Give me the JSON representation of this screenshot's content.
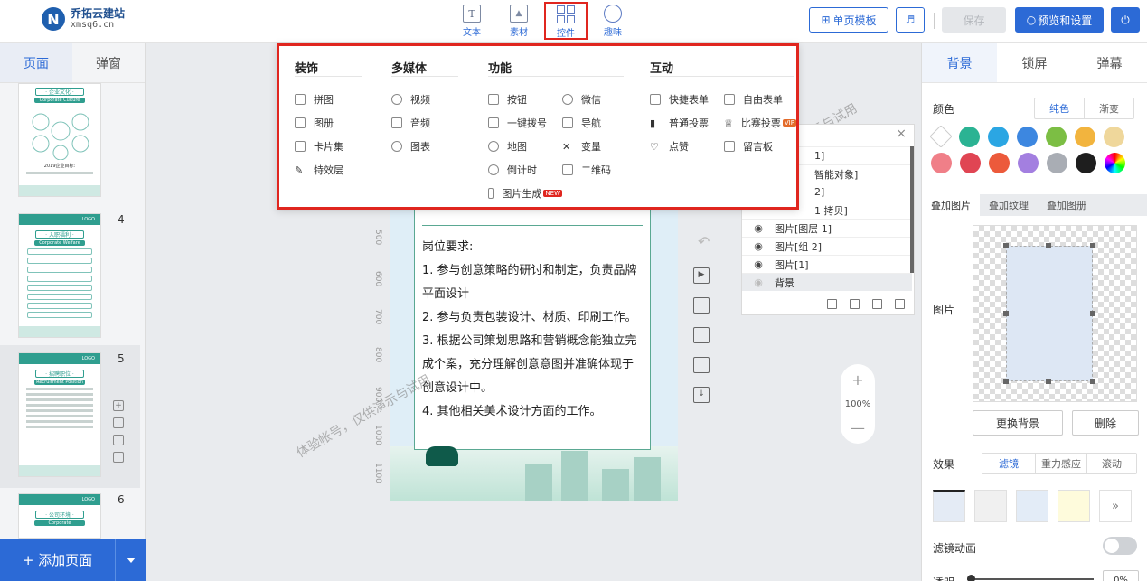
{
  "app": {
    "logo_mark": "N",
    "name": "乔拓云建站",
    "domain": "xmsq6.cn"
  },
  "toolbar": {
    "tools": [
      {
        "label": "文本",
        "icon": "text-icon",
        "glyph": "T"
      },
      {
        "label": "素材",
        "icon": "image-icon",
        "glyph": "▲"
      },
      {
        "label": "控件",
        "icon": "widget-grid-icon",
        "glyph": ""
      },
      {
        "label": "趣味",
        "icon": "bulb-icon",
        "glyph": ""
      }
    ],
    "template_label": "单页模板",
    "music_glyph": "♬",
    "save_label": "保存",
    "preview_label": "预览和设置",
    "power_glyph": "⏻",
    "template_icon": "⊞",
    "search_glyph": "○"
  },
  "left": {
    "tabs": [
      "页面",
      "弹窗"
    ],
    "pages": [
      {
        "num": "",
        "title": "· 企业文化 ·",
        "sub": "Corporate Culture",
        "caption": "2019企业目标:"
      },
      {
        "num": "4",
        "title": "· 入职福利 ·",
        "sub": "Corporate Welfare",
        "logo": "LOGO"
      },
      {
        "num": "5",
        "title": "· 招聘职位 ·",
        "sub": "Recruitment Position",
        "logo": "LOGO"
      },
      {
        "num": "6",
        "title": "· 公司环境 ·",
        "sub": "Corporate Environment",
        "logo": "LOGO"
      }
    ],
    "add_page_label": "+ 添加页面"
  },
  "dropdown": {
    "columns": [
      {
        "head": "装饰",
        "items": [
          {
            "label": "拼图",
            "icon": "puzzle-icon"
          },
          {
            "label": "图册",
            "icon": "album-icon"
          },
          {
            "label": "卡片集",
            "icon": "card-set-icon"
          },
          {
            "label": "特效层",
            "icon": "effect-layer-icon"
          }
        ]
      },
      {
        "head": "多媒体",
        "items": [
          {
            "label": "视频",
            "icon": "video-icon"
          },
          {
            "label": "音频",
            "icon": "audio-icon"
          },
          {
            "label": "图表",
            "icon": "chart-icon"
          }
        ]
      },
      {
        "head": "功能",
        "items": [
          {
            "label": "按钮",
            "icon": "button-icon"
          },
          {
            "label": "一键拨号",
            "icon": "phone-dial-icon"
          },
          {
            "label": "地图",
            "icon": "map-pin-icon"
          },
          {
            "label": "倒计时",
            "icon": "clock-icon"
          },
          {
            "label": "图片生成",
            "icon": "image-gen-icon",
            "badge": "NEW"
          }
        ]
      },
      {
        "head": "",
        "items": [
          {
            "label": "微信",
            "icon": "wechat-icon"
          },
          {
            "label": "导航",
            "icon": "nav-icon"
          },
          {
            "label": "变量",
            "icon": "variable-icon"
          },
          {
            "label": "二维码",
            "icon": "qrcode-icon"
          }
        ]
      },
      {
        "head": "互动",
        "items": [
          {
            "label": "快捷表单",
            "icon": "quick-form-icon"
          },
          {
            "label": "普通投票",
            "icon": "vote-icon"
          },
          {
            "label": "点赞",
            "icon": "heart-icon"
          }
        ]
      },
      {
        "head": "",
        "items": [
          {
            "label": "自由表单",
            "icon": "free-form-icon"
          },
          {
            "label": "比赛投票",
            "icon": "trophy-icon",
            "badge": "VIP"
          },
          {
            "label": "留言板",
            "icon": "message-board-icon"
          }
        ]
      }
    ]
  },
  "canvas": {
    "content_lines": [
      "岗位要求:",
      "1. 参与创意策略的研讨和制定，负责品牌",
      "平面设计",
      "2. 参与负责包装设计、材质、印刷工作。",
      "3. 根据公司策划思路和营销概念能独立完",
      "成个案，充分理解创意意图并准确体现于",
      "创意设计中。",
      "4. 其他相关美术设计方面的工作。"
    ],
    "ruler": [
      "500",
      "600",
      "700",
      "800",
      "900",
      "1000",
      "1100"
    ],
    "watermark": "体验帐号，仅供演示与试用",
    "zoom_plus": "+",
    "zoom_value": "100%",
    "zoom_minus": "—",
    "undo_glyph": "↶"
  },
  "layers": {
    "close_glyph": "×",
    "rows": [
      {
        "label": "1]",
        "eye": "",
        "state": ""
      },
      {
        "label": "智能对象]",
        "eye": "",
        "state": ""
      },
      {
        "label": "2]",
        "eye": "",
        "state": ""
      },
      {
        "label": "1 拷贝]",
        "eye": "",
        "state": ""
      },
      {
        "label": "图片[图层 1]",
        "eye": "◉",
        "state": ""
      },
      {
        "label": "图片[组 2]",
        "eye": "◉",
        "state": ""
      },
      {
        "label": "图片[1]",
        "eye": "◉",
        "state": ""
      },
      {
        "label": "背景",
        "eye": "◉",
        "state": "dim"
      }
    ]
  },
  "right": {
    "tabs": [
      "背景",
      "锁屏",
      "弹幕"
    ],
    "color_label": "颜色",
    "color_modes": [
      "纯色",
      "渐变"
    ],
    "swatches": [
      "#ffffff",
      "#2bb393",
      "#2ba6e3",
      "#3d87e0",
      "#7cbe44",
      "#f2b43e",
      "#efd79b",
      "#f07f88",
      "#e04553",
      "#ec5a3b",
      "#a37fe0",
      "#a9adb4",
      "#1e1e1e",
      "rainbow"
    ],
    "overlay_tabs": [
      "叠加图片",
      "叠加纹理",
      "叠加图册"
    ],
    "image_label": "图片",
    "replace_bg": "更换背景",
    "delete": "删除",
    "effect_label": "效果",
    "effect_modes": [
      "滤镜",
      "重力感应",
      "滚动"
    ],
    "more_glyph": "»",
    "filter_anim_label": "滤镜动画",
    "opacity_label": "透明",
    "opacity_value": "0%"
  }
}
